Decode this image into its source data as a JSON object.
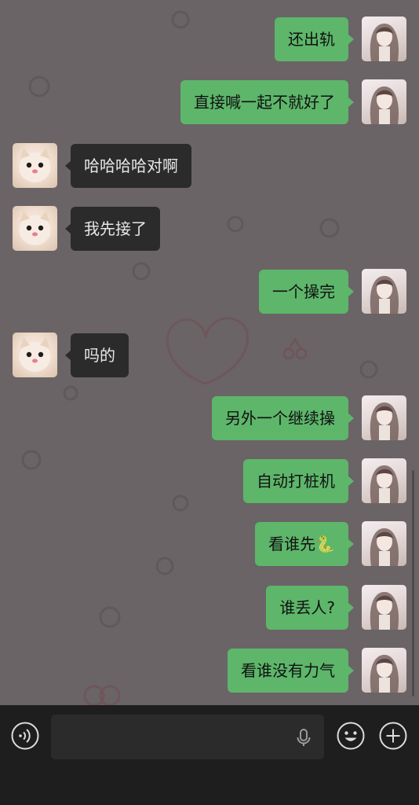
{
  "conversation": {
    "messages": [
      {
        "sender": "me",
        "text": "还出轨"
      },
      {
        "sender": "me",
        "text": "直接喊一起不就好了"
      },
      {
        "sender": "other",
        "text": "哈哈哈哈对啊"
      },
      {
        "sender": "other",
        "text": "我先接了"
      },
      {
        "sender": "me",
        "text": "一个操完"
      },
      {
        "sender": "other",
        "text": "吗的"
      },
      {
        "sender": "me",
        "text": "另外一个继续操"
      },
      {
        "sender": "me",
        "text": "自动打桩机"
      },
      {
        "sender": "me",
        "text": "看谁先🐍"
      },
      {
        "sender": "me",
        "text": "谁丢人?"
      },
      {
        "sender": "me",
        "text": "看谁没有力气"
      }
    ]
  },
  "input_bar": {
    "icons": [
      "voice-icon",
      "microphone-icon",
      "emoji-icon",
      "plus-icon"
    ]
  },
  "colors": {
    "my_bubble": "#5db66a",
    "other_bubble": "#2b2b2b",
    "chat_background": "#6a6466",
    "input_bar_background": "#1e1e1e"
  }
}
